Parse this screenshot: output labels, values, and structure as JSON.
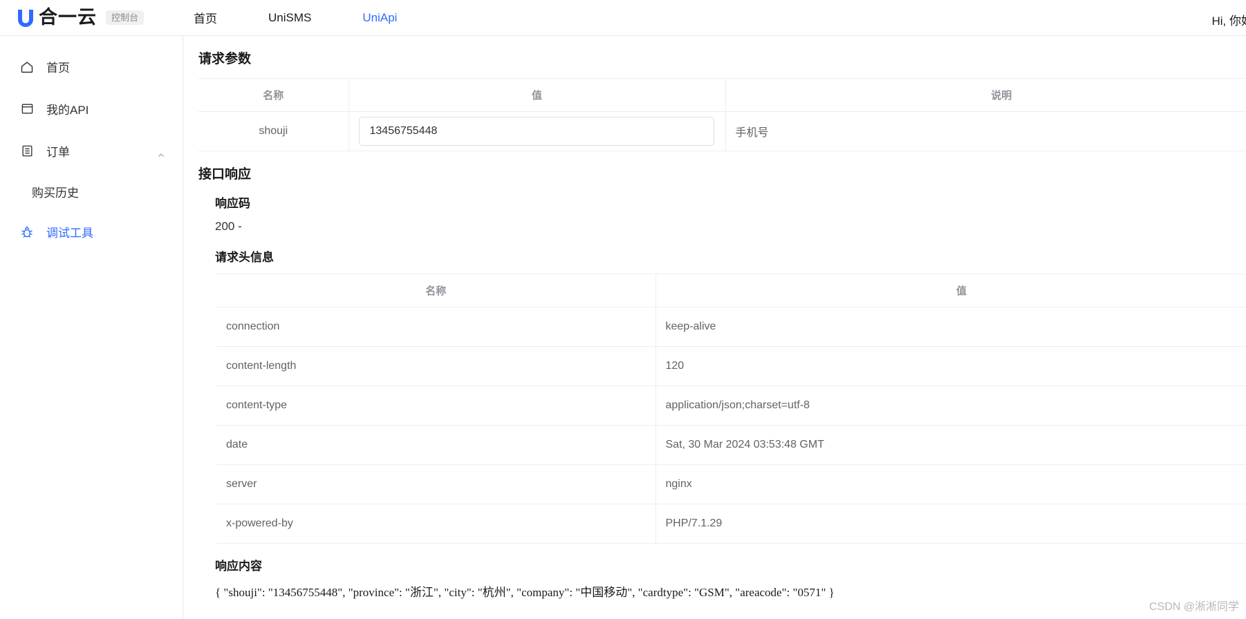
{
  "header": {
    "brand_name": "合一云",
    "console_badge": "控制台",
    "nav": [
      {
        "label": "首页",
        "active": false
      },
      {
        "label": "UniSMS",
        "active": false
      },
      {
        "label": "UniApi",
        "active": true
      }
    ],
    "greeting": "Hi, 你好",
    "accent_color": "#2f6bff"
  },
  "sidebar": {
    "items": [
      {
        "label": "首页",
        "icon": "home-icon"
      },
      {
        "label": "我的API",
        "icon": "window-icon"
      },
      {
        "label": "订单",
        "icon": "clipboard-icon",
        "expanded": true
      },
      {
        "label": "购买历史",
        "icon": "",
        "sub": true
      },
      {
        "label": "调试工具",
        "icon": "bug-icon",
        "active": true
      }
    ]
  },
  "main": {
    "request_params": {
      "title": "请求参数",
      "columns": [
        "名称",
        "值",
        "说明"
      ],
      "rows": [
        {
          "name": "shouji",
          "value": "13456755448",
          "desc": "手机号"
        }
      ]
    },
    "api_response": {
      "title": "接口响应",
      "status_code_label": "响应码",
      "status_code_value": "200 -",
      "headers_title": "请求头信息",
      "headers_columns": [
        "名称",
        "值"
      ],
      "headers_rows": [
        {
          "name": "connection",
          "value": "keep-alive"
        },
        {
          "name": "content-length",
          "value": "120"
        },
        {
          "name": "content-type",
          "value": "application/json;charset=utf-8"
        },
        {
          "name": "date",
          "value": "Sat, 30 Mar 2024 03:53:48 GMT"
        },
        {
          "name": "server",
          "value": "nginx"
        },
        {
          "name": "x-powered-by",
          "value": "PHP/7.1.29"
        }
      ],
      "body_title": "响应内容",
      "body_text": "{ \"shouji\": \"13456755448\", \"province\": \"浙江\", \"city\": \"杭州\", \"company\": \"中国移动\", \"cardtype\": \"GSM\", \"areacode\": \"0571\" }"
    }
  },
  "watermark": "CSDN @淅淅同学"
}
